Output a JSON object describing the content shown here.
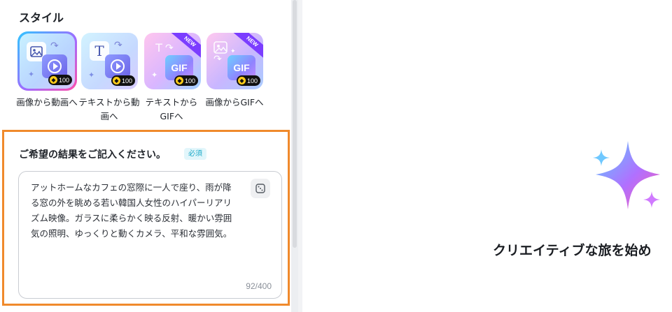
{
  "style_section": {
    "title": "スタイル",
    "cards": [
      {
        "label": "画像から動画へ",
        "credits": "100",
        "selected": true,
        "is_new": false,
        "icon": "image-to-video-icon"
      },
      {
        "label": "テキストから動画へ",
        "credits": "100",
        "selected": false,
        "is_new": false,
        "icon": "text-to-video-icon"
      },
      {
        "label": "テキストからGIFへ",
        "credits": "100",
        "selected": false,
        "is_new": true,
        "icon": "text-to-gif-icon"
      },
      {
        "label": "画像からGIFへ",
        "credits": "100",
        "selected": false,
        "is_new": true,
        "icon": "image-to-gif-icon"
      }
    ],
    "new_badge": "NEW",
    "gif_text": "GIF",
    "text_glyph": "T"
  },
  "prompt_section": {
    "heading": "ご希望の結果をご記入ください。",
    "required_label": "必須",
    "value": "アットホームなカフェの窓際に一人で座り、雨が降る窓の外を眺める若い韓国人女性のハイパーリアリズム映像。ガラスに柔らかく映る反射、暖かい雰囲気の照明、ゆっくりと動くカメラ、平和な雰囲気。",
    "char_count": "92/400"
  },
  "preview": {
    "hero_text": "クリエイティブな旅を始め"
  },
  "colors": {
    "highlight": "#f08a2c",
    "required_bg": "#e2f6fb",
    "required_fg": "#1aa9c8",
    "credit_coin": "#ffcc1a",
    "new_ribbon": "#7b3dff"
  }
}
